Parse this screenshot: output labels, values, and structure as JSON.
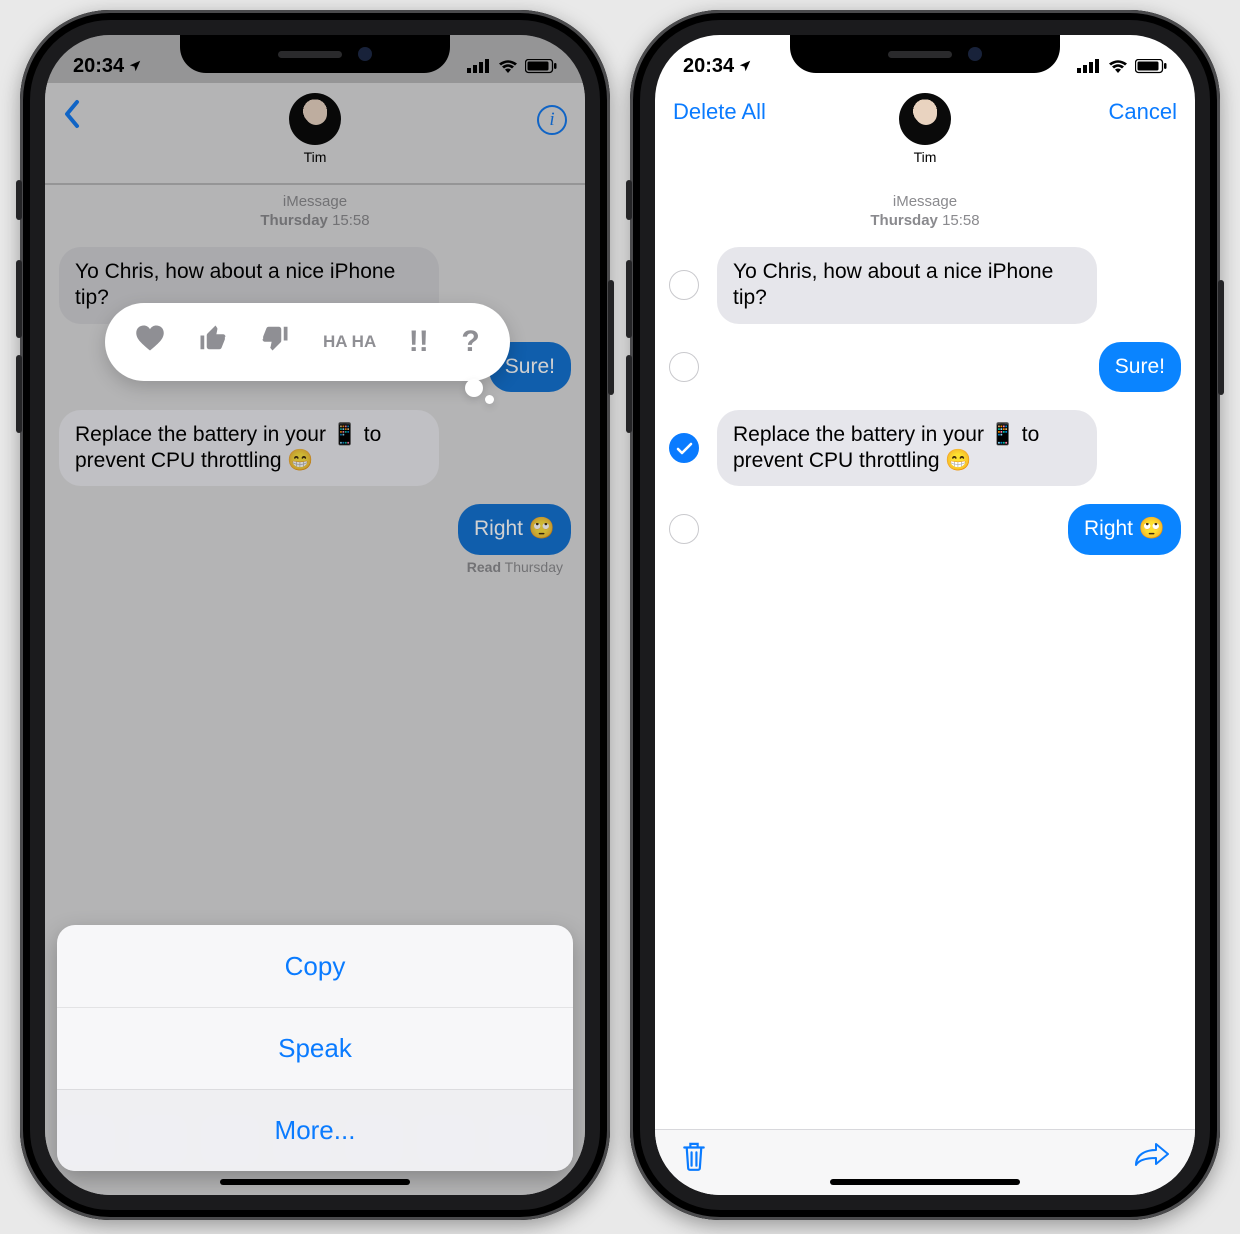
{
  "status": {
    "time": "20:34"
  },
  "left": {
    "header": {
      "contact": "Tim"
    },
    "meta": {
      "service": "iMessage",
      "day": "Thursday",
      "time": "15:58"
    },
    "messages": {
      "m0": "Yo Chris, how about a nice iPhone tip?",
      "m1": "Sure!",
      "m2": "Replace the battery in your 📱 to prevent CPU throttling 😁",
      "m3": "Right 🙄"
    },
    "receipt": {
      "label": "Read",
      "when": "Thursday"
    },
    "tapbacks": {
      "heart": "♥",
      "like": "👍",
      "dislike": "👎",
      "haha": "HA HA",
      "emphasize": "!!",
      "question": "?"
    },
    "sheet": {
      "copy": "Copy",
      "speak": "Speak",
      "more": "More..."
    }
  },
  "right": {
    "header": {
      "deleteAll": "Delete All",
      "cancel": "Cancel",
      "contact": "Tim"
    },
    "meta": {
      "service": "iMessage",
      "day": "Thursday",
      "time": "15:58"
    },
    "messages": {
      "m0": "Yo Chris, how about a nice iPhone tip?",
      "m1": "Sure!",
      "m2": "Replace the battery in your 📱 to prevent CPU throttling 😁",
      "m3": "Right 🙄"
    },
    "selection": {
      "m0": false,
      "m1": false,
      "m2": true,
      "m3": false
    }
  }
}
